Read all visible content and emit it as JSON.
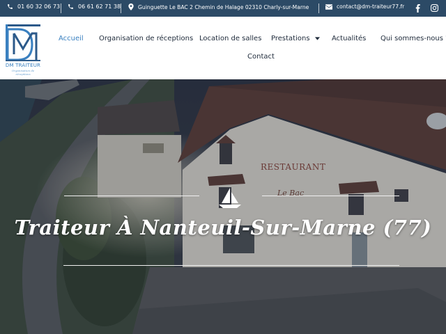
{
  "topbar": {
    "phone1": "01 60 32 06 73",
    "phone2": "06 61 62 71 38",
    "address": "Guinguette Le BAC 2 Chemin de Halage 02310 Charly-sur-Marne",
    "email": "contact@dm-traiteur77.fr",
    "social": [
      "facebook-icon",
      "instagram-icon"
    ]
  },
  "logo": {
    "name": "DM TRAITEUR",
    "tagline": "Organisation de réceptions"
  },
  "nav": {
    "items": [
      {
        "label": "Accueil",
        "active": true
      },
      {
        "label": "Organisation de réceptions"
      },
      {
        "label": "Location de salles"
      },
      {
        "label": "Prestations",
        "has_dropdown": true
      },
      {
        "label": "Actualités"
      },
      {
        "label": "Qui sommes-nous ?"
      },
      {
        "label": "Contact"
      }
    ]
  },
  "hero": {
    "title": "Traiteur À Nanteuil-Sur-Marne (77)",
    "sign_restaurant": "RESTAURANT",
    "sign_logo": "Le Bac"
  },
  "colors": {
    "topbar_bg": "#2c4a66",
    "accent": "#3a80c0",
    "nav_text": "#1e2a3a"
  }
}
